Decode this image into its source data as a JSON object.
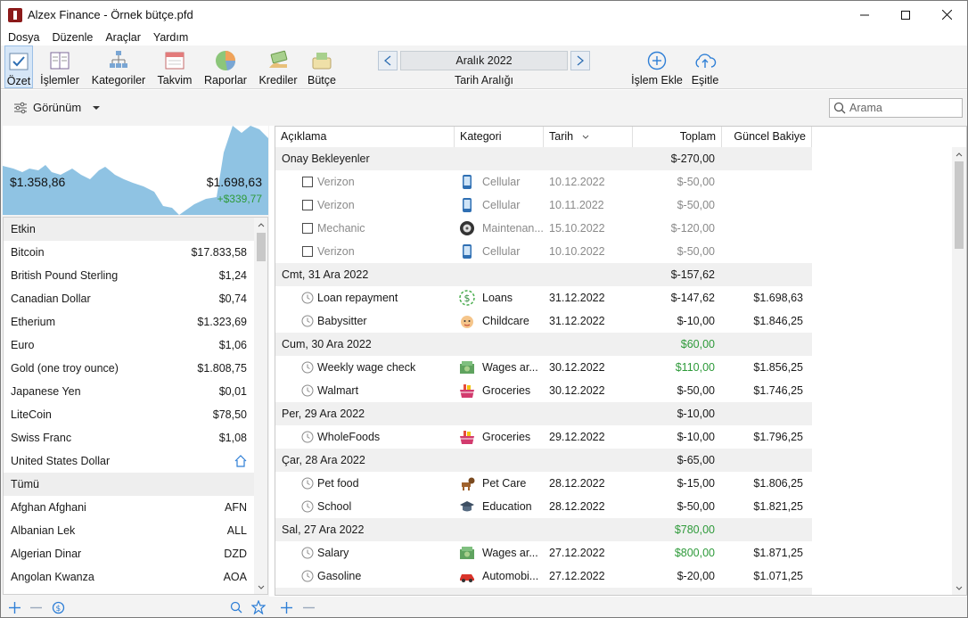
{
  "window": {
    "title": "Alzex Finance - Örnek bütçe.pfd"
  },
  "menu": [
    "Dosya",
    "Düzenle",
    "Araçlar",
    "Yardım"
  ],
  "toolbar": {
    "summary": "Özet",
    "transactions": "İşlemler",
    "categories": "Kategoriler",
    "calendar": "Takvim",
    "reports": "Raporlar",
    "loans": "Krediler",
    "budget": "Bütçe",
    "period": "Aralık 2022",
    "period_label": "Tarih Aralığı",
    "add_transaction": "İşlem Ekle",
    "sync": "Eşitle"
  },
  "subbar": {
    "view": "Görünüm",
    "search_placeholder": "Arama"
  },
  "chart": {
    "start_value": "$1.358,86",
    "end_value": "$1.698,63",
    "change": "+$339,77",
    "fill_color": "#8fc3e3"
  },
  "currencies": {
    "active_header": "Etkin",
    "active": [
      {
        "name": "Bitcoin",
        "value": "$17.833,58"
      },
      {
        "name": "British Pound Sterling",
        "value": "$1,24"
      },
      {
        "name": "Canadian Dollar",
        "value": "$0,74"
      },
      {
        "name": "Etherium",
        "value": "$1.323,69"
      },
      {
        "name": "Euro",
        "value": "$1,06"
      },
      {
        "name": "Gold (one troy ounce)",
        "value": "$1.808,75"
      },
      {
        "name": "Japanese Yen",
        "value": "$0,01"
      },
      {
        "name": "LiteCoin",
        "value": "$78,50"
      },
      {
        "name": "Swiss Franc",
        "value": "$1,08"
      },
      {
        "name": "United States Dollar",
        "value": "",
        "icon": "home-icon"
      }
    ],
    "all_header": "Tümü",
    "all": [
      {
        "name": "Afghan Afghani",
        "value": "AFN"
      },
      {
        "name": "Albanian Lek",
        "value": "ALL"
      },
      {
        "name": "Algerian Dinar",
        "value": "DZD"
      },
      {
        "name": "Angolan Kwanza",
        "value": "AOA"
      }
    ]
  },
  "table": {
    "columns": [
      "Açıklama",
      "Kategori",
      "Tarih",
      "Toplam",
      "Güncel Bakiye"
    ],
    "rows": [
      {
        "type": "group",
        "desc": "Onay Bekleyenler",
        "total": "$-270,00"
      },
      {
        "type": "pending",
        "desc": "Verizon",
        "cat": "Cellular",
        "icon": "phone-icon",
        "date": "10.12.2022",
        "total": "$-50,00",
        "balance": ""
      },
      {
        "type": "pending",
        "desc": "Verizon",
        "cat": "Cellular",
        "icon": "phone-icon",
        "date": "10.11.2022",
        "total": "$-50,00",
        "balance": ""
      },
      {
        "type": "pending",
        "desc": "Mechanic",
        "cat": "Maintenan...",
        "icon": "wheel-icon",
        "date": "15.10.2022",
        "total": "$-120,00",
        "balance": ""
      },
      {
        "type": "pending",
        "desc": "Verizon",
        "cat": "Cellular",
        "icon": "phone-icon",
        "date": "10.10.2022",
        "total": "$-50,00",
        "balance": ""
      },
      {
        "type": "group",
        "desc": "Cmt, 31 Ara 2022",
        "total": "$-157,62"
      },
      {
        "type": "item",
        "desc": "Loan repayment",
        "cat": "Loans",
        "icon": "loan-icon",
        "date": "31.12.2022",
        "total": "$-147,62",
        "balance": "$1.698,63"
      },
      {
        "type": "item",
        "desc": "Babysitter",
        "cat": "Childcare",
        "icon": "baby-icon",
        "date": "31.12.2022",
        "total": "$-10,00",
        "balance": "$1.846,25"
      },
      {
        "type": "group",
        "desc": "Cum, 30 Ara 2022",
        "total": "$60,00",
        "positive": true
      },
      {
        "type": "item",
        "desc": "Weekly wage check",
        "cat": "Wages ar...",
        "icon": "money-icon",
        "date": "30.12.2022",
        "total": "$110,00",
        "balance": "$1.856,25",
        "positive": true
      },
      {
        "type": "item",
        "desc": "Walmart",
        "cat": "Groceries",
        "icon": "basket-icon",
        "date": "30.12.2022",
        "total": "$-50,00",
        "balance": "$1.746,25"
      },
      {
        "type": "group",
        "desc": "Per, 29 Ara 2022",
        "total": "$-10,00"
      },
      {
        "type": "item",
        "desc": "WholeFoods",
        "cat": "Groceries",
        "icon": "basket-icon",
        "date": "29.12.2022",
        "total": "$-10,00",
        "balance": "$1.796,25"
      },
      {
        "type": "group",
        "desc": "Çar, 28 Ara 2022",
        "total": "$-65,00"
      },
      {
        "type": "item",
        "desc": "Pet food",
        "cat": "Pet Care",
        "icon": "dog-icon",
        "date": "28.12.2022",
        "total": "$-15,00",
        "balance": "$1.806,25"
      },
      {
        "type": "item",
        "desc": "School",
        "cat": "Education",
        "icon": "graduation-cap-icon",
        "date": "28.12.2022",
        "total": "$-50,00",
        "balance": "$1.821,25"
      },
      {
        "type": "group",
        "desc": "Sal, 27 Ara 2022",
        "total": "$780,00",
        "positive": true
      },
      {
        "type": "item",
        "desc": "Salary",
        "cat": "Wages ar...",
        "icon": "money-icon",
        "date": "27.12.2022",
        "total": "$800,00",
        "balance": "$1.871,25",
        "positive": true
      },
      {
        "type": "item",
        "desc": "Gasoline",
        "cat": "Automobi...",
        "icon": "car-icon",
        "date": "27.12.2022",
        "total": "$-20,00",
        "balance": "$1.071,25"
      }
    ]
  }
}
